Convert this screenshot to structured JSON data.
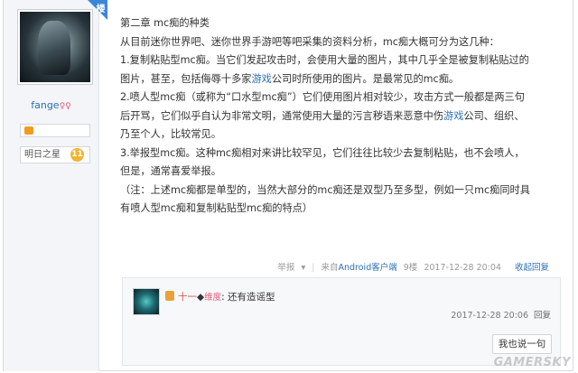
{
  "author": {
    "badge": "楼主",
    "name": "fange",
    "name_decoration": "♀♀",
    "level_title": "明日之星",
    "level_num": "11"
  },
  "post": {
    "lines": [
      "第二章 mc痴的种类",
      "从目前迷你世界吧、迷你世界手游吧等吧采集的资料分析，mc痴大概可分为这几种：",
      "1.复制粘贴型mc痴。当它们发起攻击时，会使用大量的图片，其中几乎全是被复制粘贴过的",
      "图片，甚至，包括侮辱十多家",
      "2.喷人型mc痴（或称为“口水型mc痴”）它们使用图片相对较少，攻击方式一般都是两三句",
      "后开骂，它们似乎自认为非常文明，通常使用大量的污言秽语来恶意中伤",
      "乃至个人，比较常见。",
      "3.举报型mc痴。这种mc痴相对来讲比较罕见，它们往往比较少去复制粘贴，也不会喷人，",
      "但是，通常喜爱举报。",
      "（注：上述mc痴都是单型的，当然大部分的mc痴还是双型乃至多型，例如一只mc痴同时具",
      "有喷人型mc痴和复制粘贴型mc痴的特点）"
    ],
    "line3_link": "游戏",
    "line3_tail": "公司时所使用的图片。是最常见的mc痴。",
    "line5_link": "游戏",
    "line5_tail": "公司、组织、"
  },
  "tail": {
    "report": "举报",
    "caret": "▾",
    "separator": "|",
    "from_prefix": "来自",
    "client": "Android客户端",
    "floor": "9楼",
    "time": "2017-12-28 20:04",
    "collapse_reply": "收起回复"
  },
  "sub_reply": {
    "user": "十一",
    "diamond": "◆",
    "meta": "维度",
    "text": ": 还有造谣型",
    "time": "2017-12-28 20:06",
    "reply": "回复",
    "say_button": "我也说一句"
  },
  "watermark": "GAMERSKY",
  "colors": {
    "link": "#2b6fb5",
    "host_badge": "#3b86d9",
    "level_badge": "#f2b531"
  }
}
